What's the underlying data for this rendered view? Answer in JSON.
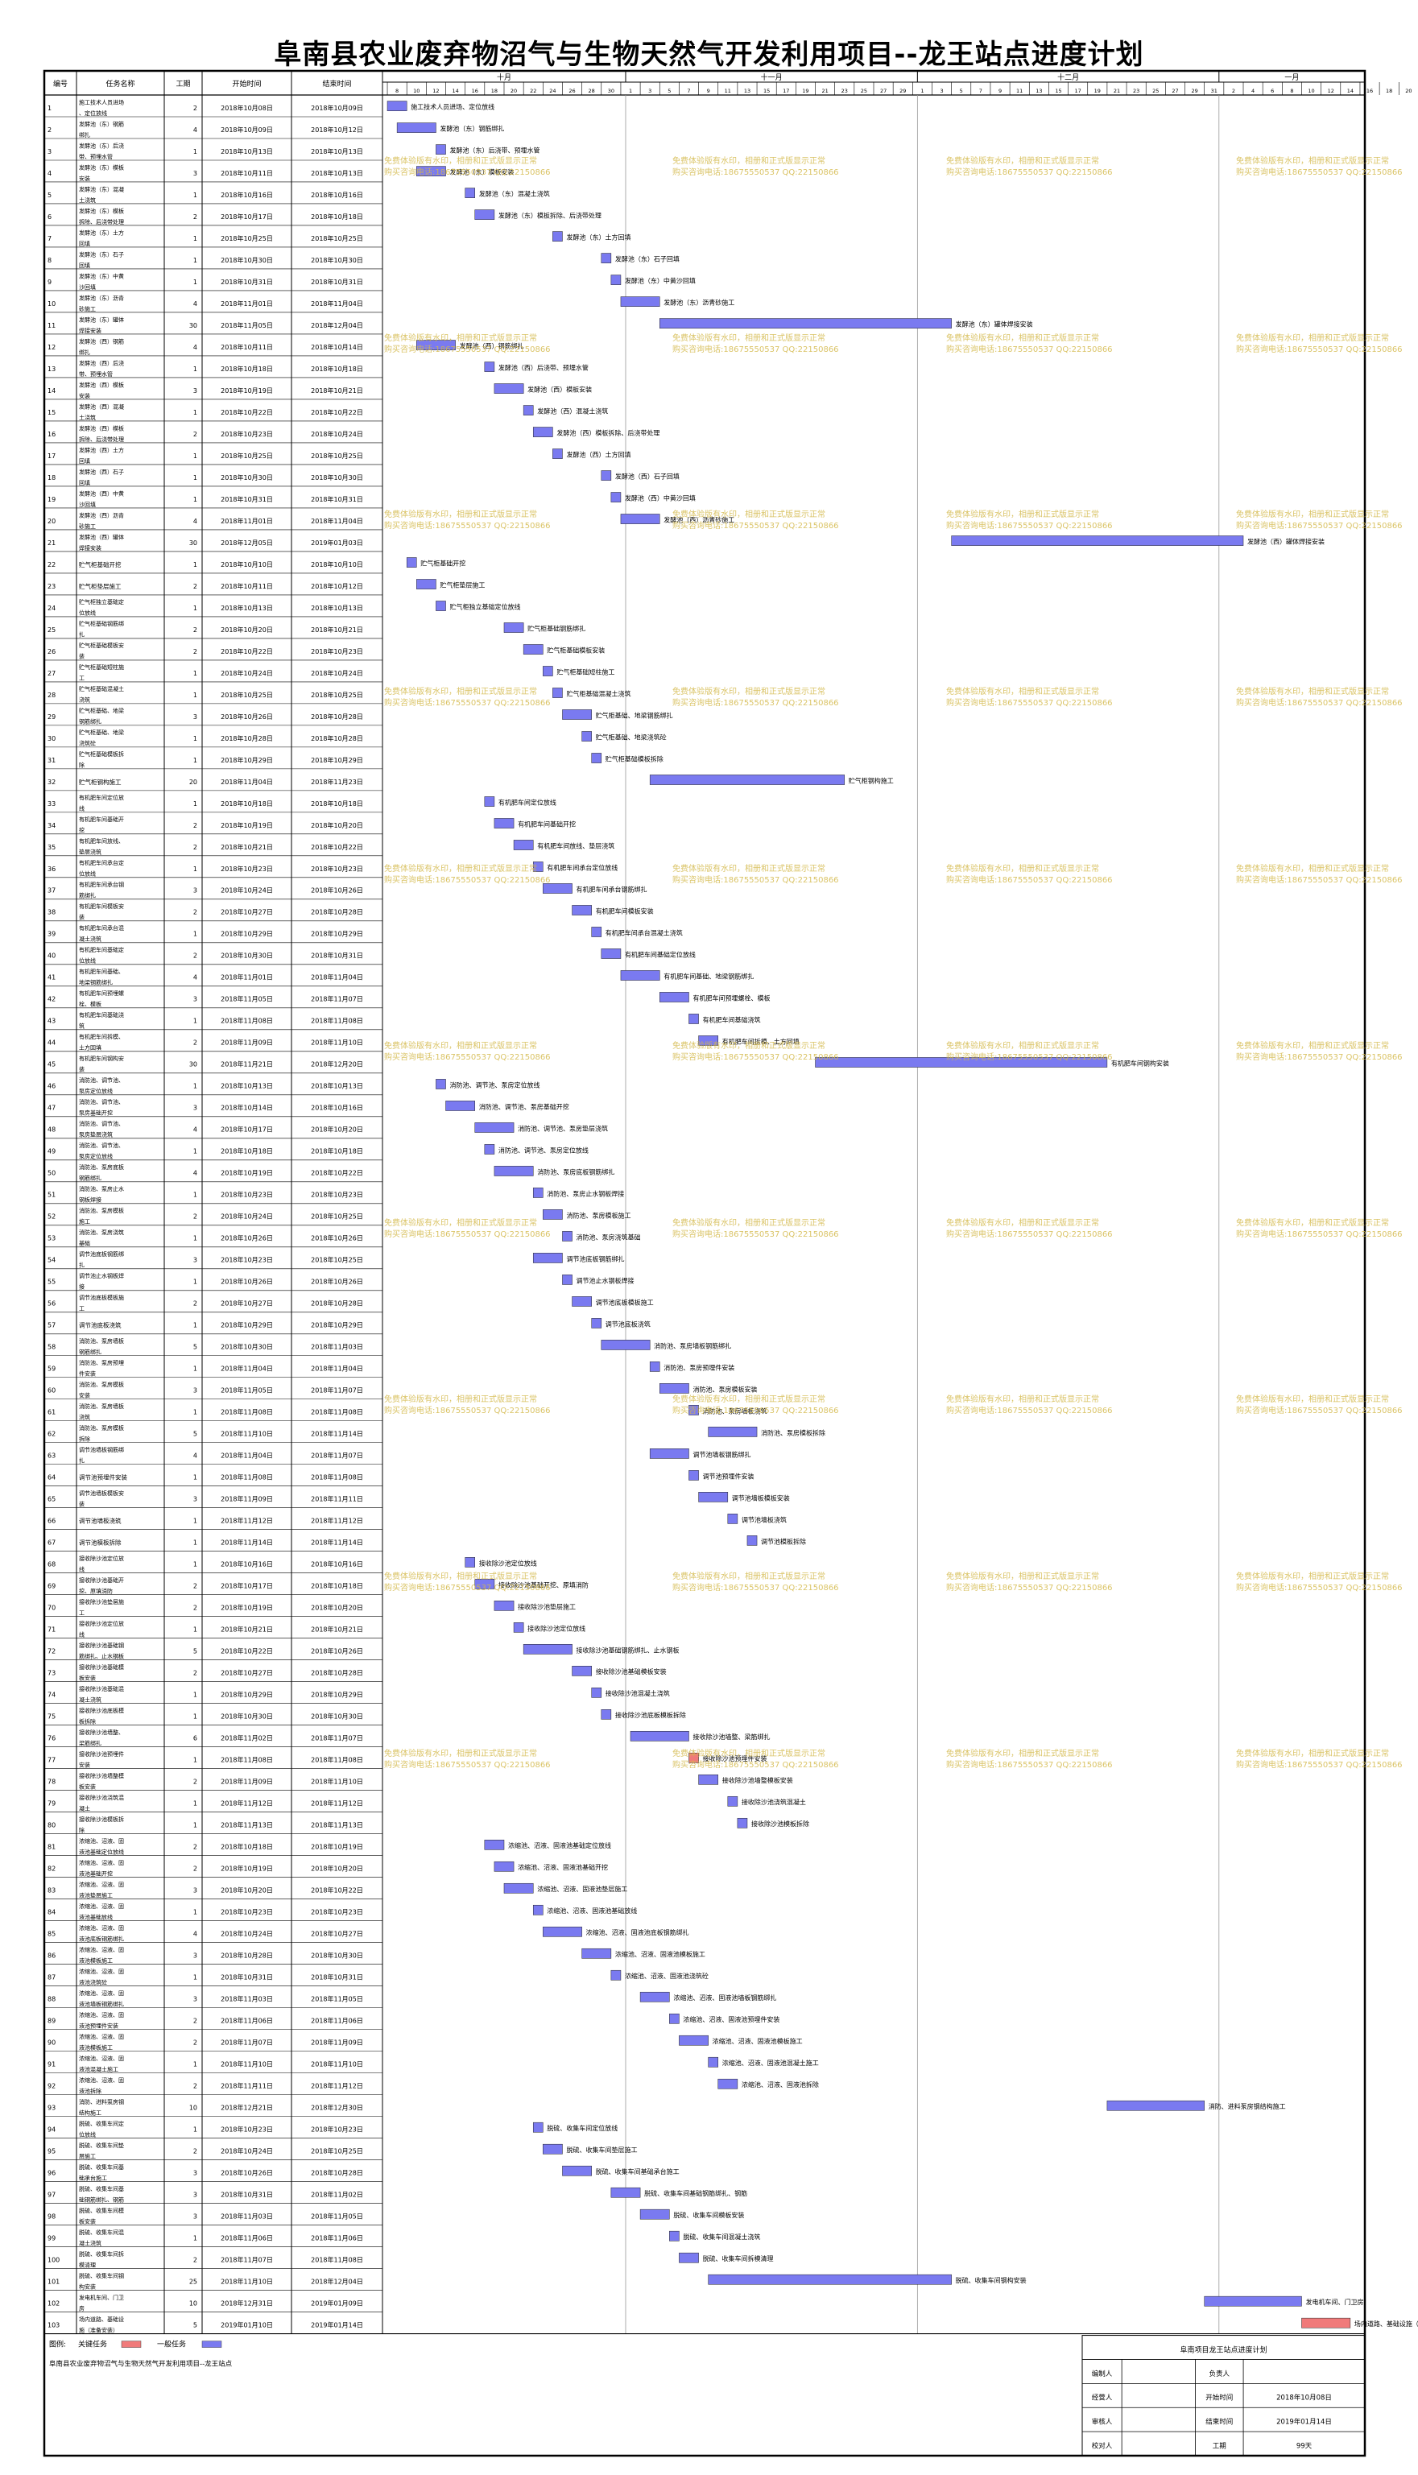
{
  "title": "阜南县农业废弃物沼气与生物天然气开发利用项目--龙王站点进度计划",
  "headers": {
    "id": "编号",
    "name": "任务名称",
    "duration": "工期",
    "start": "开始时间",
    "end": "结束时间"
  },
  "months": [
    "十月",
    "十一月",
    "十二月",
    "一月"
  ],
  "day_labels": [
    "8",
    "10",
    "12",
    "14",
    "16",
    "18",
    "20",
    "22",
    "24",
    "26",
    "28",
    "30",
    "1",
    "3",
    "5",
    "7",
    "9",
    "11",
    "13",
    "15",
    "17",
    "19",
    "21",
    "23",
    "25",
    "27",
    "29",
    "1",
    "3",
    "5",
    "7",
    "9",
    "11",
    "13",
    "15",
    "17",
    "19",
    "21",
    "23",
    "25",
    "27",
    "29",
    "31",
    "2",
    "4",
    "6",
    "8",
    "10",
    "12",
    "14",
    "16",
    "18",
    "20",
    "22",
    "24",
    "26",
    "28",
    "30",
    "1"
  ],
  "watermark_lines": [
    "免费体验版有水印，相册和正式版显示正常",
    "购买咨询电话:18675550537 QQ:22150866"
  ],
  "legend": {
    "label": "图例:",
    "critical": "关键任务",
    "normal": "一般任务",
    "critical_color": "#f07a7a",
    "normal_color": "#7a7af0",
    "project_note": "阜南县农业废弃物沼气与生物天然气开发利用项目--龙王站点"
  },
  "info_box": {
    "title": "阜南项目龙王站点进度计划",
    "rows": [
      [
        "编制人",
        "",
        "负责人",
        ""
      ],
      [
        "经营人",
        "",
        "开始时间",
        "2018年10月08日"
      ],
      [
        "审核人",
        "",
        "结束时间",
        "2019年01月14日"
      ],
      [
        "校对人",
        "",
        "工期",
        "99天"
      ]
    ]
  },
  "chart_data": {
    "type": "gantt",
    "title": "阜南县农业废弃物沼气与生物天然气开发利用项目--龙王站点进度计划",
    "x_range": [
      "2018-10-07",
      "2019-01-16"
    ],
    "tasks": [
      [
        "1",
        "施工技术人员进场、定位放线",
        2,
        "2018年10月08日",
        "2018年10月09日",
        "施工技术人员进场、定位放线",
        0
      ],
      [
        "2",
        "发酵池（东）钢筋绑扎",
        4,
        "2018年10月09日",
        "2018年10月12日",
        "发酵池（东）钢筋绑扎",
        0
      ],
      [
        "3",
        "发酵池（东）后浇带、预埋水管",
        1,
        "2018年10月13日",
        "2018年10月13日",
        "发酵池（东）后浇带、预埋水管",
        0
      ],
      [
        "4",
        "发酵池（东）模板安装",
        3,
        "2018年10月11日",
        "2018年10月13日",
        "发酵池（东）模板安装",
        0
      ],
      [
        "5",
        "发酵池（东）混凝土浇筑",
        1,
        "2018年10月16日",
        "2018年10月16日",
        "发酵池（东）混凝土浇筑",
        0
      ],
      [
        "6",
        "发酵池（东）模板拆除、后浇带处理",
        2,
        "2018年10月17日",
        "2018年10月18日",
        "发酵池（东）模板拆除、后浇带处理",
        0
      ],
      [
        "7",
        "发酵池（东）土方回填",
        1,
        "2018年10月25日",
        "2018年10月25日",
        "发酵池（东）土方回填",
        0
      ],
      [
        "8",
        "发酵池（东）石子回填",
        1,
        "2018年10月30日",
        "2018年10月30日",
        "发酵池（东）石子回填",
        0
      ],
      [
        "9",
        "发酵池（东）中黄沙回填",
        1,
        "2018年10月31日",
        "2018年10月31日",
        "发酵池（东）中黄沙回填",
        0
      ],
      [
        "10",
        "发酵池（东）沥青砂施工",
        4,
        "2018年11月01日",
        "2018年11月04日",
        "发酵池（东）沥青砂施工",
        0
      ],
      [
        "11",
        "发酵池（东）罐体焊接安装",
        30,
        "2018年11月05日",
        "2018年12月04日",
        "发酵池（东）罐体焊接安装",
        0
      ],
      [
        "12",
        "发酵池（西）钢筋绑扎",
        4,
        "2018年10月11日",
        "2018年10月14日",
        "发酵池（西）钢筋绑扎",
        0
      ],
      [
        "13",
        "发酵池（西）后浇带、预埋水管",
        1,
        "2018年10月18日",
        "2018年10月18日",
        "发酵池（西）后浇带、预埋水管",
        0
      ],
      [
        "14",
        "发酵池（西）模板安装",
        3,
        "2018年10月19日",
        "2018年10月21日",
        "发酵池（西）模板安装",
        0
      ],
      [
        "15",
        "发酵池（西）混凝土浇筑",
        1,
        "2018年10月22日",
        "2018年10月22日",
        "发酵池（西）混凝土浇筑",
        0
      ],
      [
        "16",
        "发酵池（西）模板拆除、后浇带处理",
        2,
        "2018年10月23日",
        "2018年10月24日",
        "发酵池（西）模板拆除、后浇带处理",
        0
      ],
      [
        "17",
        "发酵池（西）土方回填",
        1,
        "2018年10月25日",
        "2018年10月25日",
        "发酵池（西）土方回填",
        0
      ],
      [
        "18",
        "发酵池（西）石子回填",
        1,
        "2018年10月30日",
        "2018年10月30日",
        "发酵池（西）石子回填",
        0
      ],
      [
        "19",
        "发酵池（西）中黄沙回填",
        1,
        "2018年10月31日",
        "2018年10月31日",
        "发酵池（西）中黄沙回填",
        0
      ],
      [
        "20",
        "发酵池（西）沥青砂施工",
        4,
        "2018年11月01日",
        "2018年11月04日",
        "发酵池（西）沥青砂施工",
        0
      ],
      [
        "21",
        "发酵池（西）罐体焊接安装",
        30,
        "2018年12月05日",
        "2019年01月03日",
        "发酵池（西）罐体焊接安装",
        0
      ],
      [
        "22",
        "贮气柜基础开挖",
        1,
        "2018年10月10日",
        "2018年10月10日",
        "贮气柜基础开挖",
        0
      ],
      [
        "23",
        "贮气柜垫层施工",
        2,
        "2018年10月11日",
        "2018年10月12日",
        "贮气柜垫层施工",
        0
      ],
      [
        "24",
        "贮气柜独立基础定位放线",
        1,
        "2018年10月13日",
        "2018年10月13日",
        "贮气柜独立基础定位放线",
        0
      ],
      [
        "25",
        "贮气柜基础钢筋绑扎",
        2,
        "2018年10月20日",
        "2018年10月21日",
        "贮气柜基础钢筋绑扎",
        0
      ],
      [
        "26",
        "贮气柜基础模板安装",
        2,
        "2018年10月22日",
        "2018年10月23日",
        "贮气柜基础模板安装",
        0
      ],
      [
        "27",
        "贮气柜基础短柱施工",
        1,
        "2018年10月24日",
        "2018年10月24日",
        "贮气柜基础短柱施工",
        0
      ],
      [
        "28",
        "贮气柜基础混凝土浇筑",
        1,
        "2018年10月25日",
        "2018年10月25日",
        "贮气柜基础混凝土浇筑",
        0
      ],
      [
        "29",
        "贮气柜基础、地梁钢筋绑扎",
        3,
        "2018年10月26日",
        "2018年10月28日",
        "贮气柜基础、地梁钢筋绑扎",
        0
      ],
      [
        "30",
        "贮气柜基础、地梁浇筑砼",
        1,
        "2018年10月28日",
        "2018年10月28日",
        "贮气柜基础、地梁浇筑砼",
        0
      ],
      [
        "31",
        "贮气柜基础模板拆除",
        1,
        "2018年10月29日",
        "2018年10月29日",
        "贮气柜基础模板拆除",
        0
      ],
      [
        "32",
        "贮气柜钢构施工",
        20,
        "2018年11月04日",
        "2018年11月23日",
        "贮气柜钢构施工",
        0
      ],
      [
        "33",
        "有机肥车间定位放线",
        1,
        "2018年10月18日",
        "2018年10月18日",
        "有机肥车间定位放线",
        0
      ],
      [
        "34",
        "有机肥车间基础开挖",
        2,
        "2018年10月19日",
        "2018年10月20日",
        "有机肥车间基础开挖",
        0
      ],
      [
        "35",
        "有机肥车间放线、垫层浇筑",
        2,
        "2018年10月21日",
        "2018年10月22日",
        "有机肥车间放线、垫层浇筑",
        0
      ],
      [
        "36",
        "有机肥车间承台定位放线",
        1,
        "2018年10月23日",
        "2018年10月23日",
        "有机肥车间承台定位放线",
        0
      ],
      [
        "37",
        "有机肥车间承台钢筋绑扎",
        3,
        "2018年10月24日",
        "2018年10月26日",
        "有机肥车间承台钢筋绑扎",
        0
      ],
      [
        "38",
        "有机肥车间模板安装",
        2,
        "2018年10月27日",
        "2018年10月28日",
        "有机肥车间模板安装",
        0
      ],
      [
        "39",
        "有机肥车间承台混凝土浇筑",
        1,
        "2018年10月29日",
        "2018年10月29日",
        "有机肥车间承台混凝土浇筑",
        0
      ],
      [
        "40",
        "有机肥车间基础定位放线",
        2,
        "2018年10月30日",
        "2018年10月31日",
        "有机肥车间基础定位放线",
        0
      ],
      [
        "41",
        "有机肥车间基础、地梁钢筋绑扎",
        4,
        "2018年11月01日",
        "2018年11月04日",
        "有机肥车间基础、地梁钢筋绑扎",
        0
      ],
      [
        "42",
        "有机肥车间预埋螺栓、模板",
        3,
        "2018年11月05日",
        "2018年11月07日",
        "有机肥车间预埋螺栓、模板",
        0
      ],
      [
        "43",
        "有机肥车间基础浇筑",
        1,
        "2018年11月08日",
        "2018年11月08日",
        "有机肥车间基础浇筑",
        0
      ],
      [
        "44",
        "有机肥车间拆模、土方回填",
        2,
        "2018年11月09日",
        "2018年11月10日",
        "有机肥车间拆模、土方回填",
        0
      ],
      [
        "45",
        "有机肥车间钢构安装",
        30,
        "2018年11月21日",
        "2018年12月20日",
        "有机肥车间钢构安装",
        0
      ],
      [
        "46",
        "消防池、调节池、泵房定位放线",
        1,
        "2018年10月13日",
        "2018年10月13日",
        "消防池、调节池、泵房定位放线",
        0
      ],
      [
        "47",
        "消防池、调节池、泵房基础开挖",
        3,
        "2018年10月14日",
        "2018年10月16日",
        "消防池、调节池、泵房基础开挖",
        0
      ],
      [
        "48",
        "消防池、调节池、泵房垫层浇筑",
        4,
        "2018年10月17日",
        "2018年10月20日",
        "消防池、调节池、泵房垫层浇筑",
        0
      ],
      [
        "49",
        "消防池、调节池、泵房定位放线",
        1,
        "2018年10月18日",
        "2018年10月18日",
        "消防池、调节池、泵房定位放线",
        0
      ],
      [
        "50",
        "消防池、泵房底板钢筋绑扎",
        4,
        "2018年10月19日",
        "2018年10月22日",
        "消防池、泵房底板钢筋绑扎",
        0
      ],
      [
        "51",
        "消防池、泵房止水钢板焊接",
        1,
        "2018年10月23日",
        "2018年10月23日",
        "消防池、泵房止水钢板焊接",
        0
      ],
      [
        "52",
        "消防池、泵房模板施工",
        2,
        "2018年10月24日",
        "2018年10月25日",
        "消防池、泵房模板施工",
        0
      ],
      [
        "53",
        "消防池、泵房浇筑基础",
        1,
        "2018年10月26日",
        "2018年10月26日",
        "消防池、泵房浇筑基础",
        0
      ],
      [
        "54",
        "调节池底板钢筋绑扎",
        3,
        "2018年10月23日",
        "2018年10月25日",
        "调节池底板钢筋绑扎",
        0
      ],
      [
        "55",
        "调节池止水钢板焊接",
        1,
        "2018年10月26日",
        "2018年10月26日",
        "调节池止水钢板焊接",
        0
      ],
      [
        "56",
        "调节池底板模板施工",
        2,
        "2018年10月27日",
        "2018年10月28日",
        "调节池底板模板施工",
        0
      ],
      [
        "57",
        "调节池底板浇筑",
        1,
        "2018年10月29日",
        "2018年10月29日",
        "调节池底板浇筑",
        0
      ],
      [
        "58",
        "消防池、泵房墙板钢筋绑扎",
        5,
        "2018年10月30日",
        "2018年11月03日",
        "消防池、泵房墙板钢筋绑扎",
        0
      ],
      [
        "59",
        "消防池、泵房预埋件安装",
        1,
        "2018年11月04日",
        "2018年11月04日",
        "消防池、泵房预埋件安装",
        0
      ],
      [
        "60",
        "消防池、泵房模板安装",
        3,
        "2018年11月05日",
        "2018年11月07日",
        "消防池、泵房模板安装",
        0
      ],
      [
        "61",
        "消防池、泵房墙板浇筑",
        1,
        "2018年11月08日",
        "2018年11月08日",
        "消防池、泵房墙板浇筑",
        0
      ],
      [
        "62",
        "消防池、泵房模板拆除",
        5,
        "2018年11月10日",
        "2018年11月14日",
        "消防池、泵房模板拆除",
        0
      ],
      [
        "63",
        "调节池墙板钢筋绑扎",
        4,
        "2018年11月04日",
        "2018年11月07日",
        "调节池墙板钢筋绑扎",
        0
      ],
      [
        "64",
        "调节池预埋件安装",
        1,
        "2018年11月08日",
        "2018年11月08日",
        "调节池预埋件安装",
        0
      ],
      [
        "65",
        "调节池墙板模板安装",
        3,
        "2018年11月09日",
        "2018年11月11日",
        "调节池墙板模板安装",
        0
      ],
      [
        "66",
        "调节池墙板浇筑",
        1,
        "2018年11月12日",
        "2018年11月12日",
        "调节池墙板浇筑",
        0
      ],
      [
        "67",
        "调节池模板拆除",
        1,
        "2018年11月14日",
        "2018年11月14日",
        "调节池模板拆除",
        0
      ],
      [
        "68",
        "接收除沙池定位放线",
        1,
        "2018年10月16日",
        "2018年10月16日",
        "接收除沙池定位放线",
        0
      ],
      [
        "69",
        "接收除沙池基础开挖、原填消防",
        2,
        "2018年10月17日",
        "2018年10月18日",
        "接收除沙池基础开挖、原填消防",
        0
      ],
      [
        "70",
        "接收除沙池垫层施工",
        2,
        "2018年10月19日",
        "2018年10月20日",
        "接收除沙池垫层施工",
        0
      ],
      [
        "71",
        "接收除沙池定位放线",
        1,
        "2018年10月21日",
        "2018年10月21日",
        "接收除沙池定位放线",
        0
      ],
      [
        "72",
        "接收除沙池基础钢筋绑扎、止水钢板",
        5,
        "2018年10月22日",
        "2018年10月26日",
        "接收除沙池基础钢筋绑扎、止水钢板",
        0
      ],
      [
        "73",
        "接收除沙池基础模板安装",
        2,
        "2018年10月27日",
        "2018年10月28日",
        "接收除沙池基础模板安装",
        0
      ],
      [
        "74",
        "接收除沙池基础混凝土浇筑",
        1,
        "2018年10月29日",
        "2018年10月29日",
        "接收除沙池混凝土浇筑",
        0
      ],
      [
        "75",
        "接收除沙池底板模板拆除",
        1,
        "2018年10月30日",
        "2018年10月30日",
        "接收除沙池底板模板拆除",
        0
      ],
      [
        "76",
        "接收除沙池墙整、梁筋绑扎",
        6,
        "2018年11月02日",
        "2018年11月07日",
        "接收除沙池墙整、梁筋绑扎",
        0
      ],
      [
        "77",
        "接收除沙池预埋件安装",
        1,
        "2018年11月08日",
        "2018年11月08日",
        "接收除沙池预埋件安装",
        1
      ],
      [
        "78",
        "接收除沙池墙整模板安装",
        2,
        "2018年11月09日",
        "2018年11月10日",
        "接收除沙池墙整模板安装",
        0
      ],
      [
        "79",
        "接收除沙池浇筑混凝土",
        1,
        "2018年11月12日",
        "2018年11月12日",
        "接收除沙池浇筑混凝土",
        0
      ],
      [
        "80",
        "接收除沙池模板拆除",
        1,
        "2018年11月13日",
        "2018年11月13日",
        "接收除沙池模板拆除",
        0
      ],
      [
        "81",
        "浓缩池、沼液、固液池基础定位放线",
        2,
        "2018年10月18日",
        "2018年10月19日",
        "浓缩池、沼液、固液池基础定位放线",
        0
      ],
      [
        "82",
        "浓缩池、沼液、固液池基础开挖",
        2,
        "2018年10月19日",
        "2018年10月20日",
        "浓缩池、沼液、固液池基础开挖",
        0
      ],
      [
        "83",
        "浓缩池、沼液、固液池垫层施工",
        3,
        "2018年10月20日",
        "2018年10月22日",
        "浓缩池、沼液、固液池垫层施工",
        0
      ],
      [
        "84",
        "浓缩池、沼液、固液池基础放线",
        1,
        "2018年10月23日",
        "2018年10月23日",
        "浓缩池、沼液、固液池基础放线",
        0
      ],
      [
        "85",
        "浓缩池、沼液、固液池底板钢筋绑扎",
        4,
        "2018年10月24日",
        "2018年10月27日",
        "浓缩池、沼液、固液池底板钢筋绑扎",
        0
      ],
      [
        "86",
        "浓缩池、沼液、固液池模板施工",
        3,
        "2018年10月28日",
        "2018年10月30日",
        "浓缩池、沼液、固液池模板施工",
        0
      ],
      [
        "87",
        "浓缩池、沼液、固液池浇筑砼",
        1,
        "2018年10月31日",
        "2018年10月31日",
        "浓缩池、沼液、固液池浇筑砼",
        0
      ],
      [
        "88",
        "浓缩池、沼液、固液池墙板钢筋绑扎",
        3,
        "2018年11月03日",
        "2018年11月05日",
        "浓缩池、沼液、固液池墙板钢筋绑扎",
        0
      ],
      [
        "89",
        "浓缩池、沼液、固液池预埋件安装",
        2,
        "2018年11月06日",
        "2018年11月06日",
        "浓缩池、沼液、固液池预埋件安装",
        0
      ],
      [
        "90",
        "浓缩池、沼液、固液池模板施工",
        2,
        "2018年11月07日",
        "2018年11月09日",
        "浓缩池、沼液、固液池模板施工",
        0
      ],
      [
        "91",
        "浓缩池、沼液、固液池混凝土施工",
        1,
        "2018年11月10日",
        "2018年11月10日",
        "浓缩池、沼液、固液池混凝土施工",
        0
      ],
      [
        "92",
        "浓缩池、沼液、固液池拆除",
        2,
        "2018年11月11日",
        "2018年11月12日",
        "浓缩池、沼液、固液池拆除",
        0
      ],
      [
        "93",
        "消防、进料泵房钢结构施工",
        10,
        "2018年12月21日",
        "2018年12月30日",
        "消防、进料泵房钢结构施工",
        0
      ],
      [
        "94",
        "脱硫、收集车间定位放线",
        1,
        "2018年10月23日",
        "2018年10月23日",
        "脱硫、收集车间定位放线",
        0
      ],
      [
        "95",
        "脱硫、收集车间垫层施工",
        2,
        "2018年10月24日",
        "2018年10月25日",
        "脱硫、收集车间垫层施工",
        0
      ],
      [
        "96",
        "脱硫、收集车间基础承台施工",
        3,
        "2018年10月26日",
        "2018年10月28日",
        "脱硫、收集车间基础承台施工",
        0
      ],
      [
        "97",
        "脱硫、收集车间基础钢筋绑扎、钢筋",
        3,
        "2018年10月31日",
        "2018年11月02日",
        "脱硫、收集车间基础钢筋绑扎、钢筋",
        0
      ],
      [
        "98",
        "脱硫、收集车间模板安装",
        3,
        "2018年11月03日",
        "2018年11月05日",
        "脱硫、收集车间模板安装",
        0
      ],
      [
        "99",
        "脱硫、收集车间混凝土浇筑",
        1,
        "2018年11月06日",
        "2018年11月06日",
        "脱硫、收集车间混凝土浇筑",
        0
      ],
      [
        "100",
        "脱硫、收集车间拆模清理",
        2,
        "2018年11月07日",
        "2018年11月08日",
        "脱硫、收集车间拆模清理",
        0
      ],
      [
        "101",
        "脱硫、收集车间钢构安装",
        25,
        "2018年11月10日",
        "2018年12月04日",
        "脱硫、收集车间钢构安装",
        0
      ],
      [
        "102",
        "发电机车间、门卫房",
        10,
        "2018年12月31日",
        "2019年01月09日",
        "发电机车间、门卫房",
        0
      ],
      [
        "103",
        "场内道路、基础设施（准备安装）",
        5,
        "2019年01月10日",
        "2019年01月14日",
        "场内道路、基础设施（准备安装）",
        1
      ]
    ]
  }
}
